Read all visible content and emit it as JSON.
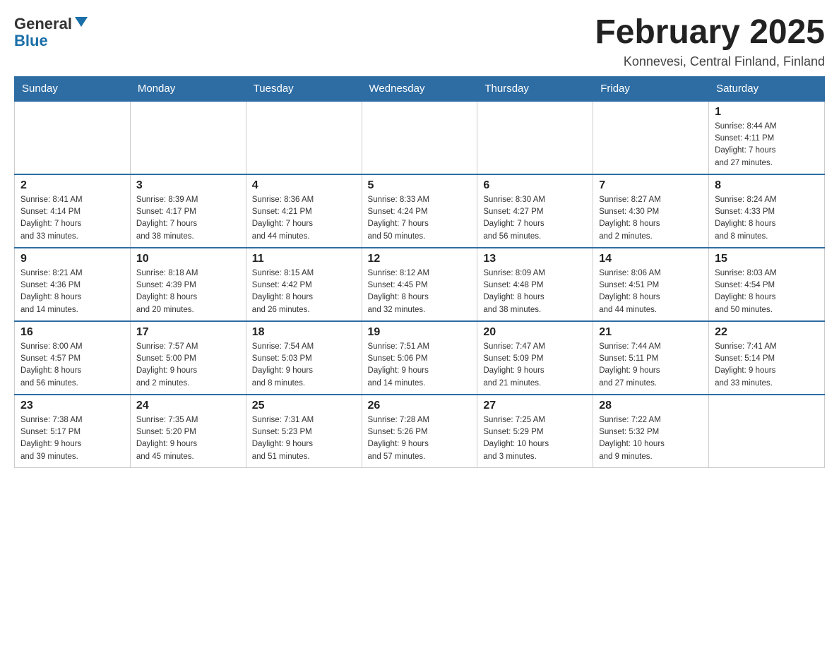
{
  "header": {
    "logo_general": "General",
    "logo_blue": "Blue",
    "month_title": "February 2025",
    "location": "Konnevesi, Central Finland, Finland"
  },
  "weekdays": [
    "Sunday",
    "Monday",
    "Tuesday",
    "Wednesday",
    "Thursday",
    "Friday",
    "Saturday"
  ],
  "weeks": [
    [
      {
        "day": "",
        "info": ""
      },
      {
        "day": "",
        "info": ""
      },
      {
        "day": "",
        "info": ""
      },
      {
        "day": "",
        "info": ""
      },
      {
        "day": "",
        "info": ""
      },
      {
        "day": "",
        "info": ""
      },
      {
        "day": "1",
        "info": "Sunrise: 8:44 AM\nSunset: 4:11 PM\nDaylight: 7 hours\nand 27 minutes."
      }
    ],
    [
      {
        "day": "2",
        "info": "Sunrise: 8:41 AM\nSunset: 4:14 PM\nDaylight: 7 hours\nand 33 minutes."
      },
      {
        "day": "3",
        "info": "Sunrise: 8:39 AM\nSunset: 4:17 PM\nDaylight: 7 hours\nand 38 minutes."
      },
      {
        "day": "4",
        "info": "Sunrise: 8:36 AM\nSunset: 4:21 PM\nDaylight: 7 hours\nand 44 minutes."
      },
      {
        "day": "5",
        "info": "Sunrise: 8:33 AM\nSunset: 4:24 PM\nDaylight: 7 hours\nand 50 minutes."
      },
      {
        "day": "6",
        "info": "Sunrise: 8:30 AM\nSunset: 4:27 PM\nDaylight: 7 hours\nand 56 minutes."
      },
      {
        "day": "7",
        "info": "Sunrise: 8:27 AM\nSunset: 4:30 PM\nDaylight: 8 hours\nand 2 minutes."
      },
      {
        "day": "8",
        "info": "Sunrise: 8:24 AM\nSunset: 4:33 PM\nDaylight: 8 hours\nand 8 minutes."
      }
    ],
    [
      {
        "day": "9",
        "info": "Sunrise: 8:21 AM\nSunset: 4:36 PM\nDaylight: 8 hours\nand 14 minutes."
      },
      {
        "day": "10",
        "info": "Sunrise: 8:18 AM\nSunset: 4:39 PM\nDaylight: 8 hours\nand 20 minutes."
      },
      {
        "day": "11",
        "info": "Sunrise: 8:15 AM\nSunset: 4:42 PM\nDaylight: 8 hours\nand 26 minutes."
      },
      {
        "day": "12",
        "info": "Sunrise: 8:12 AM\nSunset: 4:45 PM\nDaylight: 8 hours\nand 32 minutes."
      },
      {
        "day": "13",
        "info": "Sunrise: 8:09 AM\nSunset: 4:48 PM\nDaylight: 8 hours\nand 38 minutes."
      },
      {
        "day": "14",
        "info": "Sunrise: 8:06 AM\nSunset: 4:51 PM\nDaylight: 8 hours\nand 44 minutes."
      },
      {
        "day": "15",
        "info": "Sunrise: 8:03 AM\nSunset: 4:54 PM\nDaylight: 8 hours\nand 50 minutes."
      }
    ],
    [
      {
        "day": "16",
        "info": "Sunrise: 8:00 AM\nSunset: 4:57 PM\nDaylight: 8 hours\nand 56 minutes."
      },
      {
        "day": "17",
        "info": "Sunrise: 7:57 AM\nSunset: 5:00 PM\nDaylight: 9 hours\nand 2 minutes."
      },
      {
        "day": "18",
        "info": "Sunrise: 7:54 AM\nSunset: 5:03 PM\nDaylight: 9 hours\nand 8 minutes."
      },
      {
        "day": "19",
        "info": "Sunrise: 7:51 AM\nSunset: 5:06 PM\nDaylight: 9 hours\nand 14 minutes."
      },
      {
        "day": "20",
        "info": "Sunrise: 7:47 AM\nSunset: 5:09 PM\nDaylight: 9 hours\nand 21 minutes."
      },
      {
        "day": "21",
        "info": "Sunrise: 7:44 AM\nSunset: 5:11 PM\nDaylight: 9 hours\nand 27 minutes."
      },
      {
        "day": "22",
        "info": "Sunrise: 7:41 AM\nSunset: 5:14 PM\nDaylight: 9 hours\nand 33 minutes."
      }
    ],
    [
      {
        "day": "23",
        "info": "Sunrise: 7:38 AM\nSunset: 5:17 PM\nDaylight: 9 hours\nand 39 minutes."
      },
      {
        "day": "24",
        "info": "Sunrise: 7:35 AM\nSunset: 5:20 PM\nDaylight: 9 hours\nand 45 minutes."
      },
      {
        "day": "25",
        "info": "Sunrise: 7:31 AM\nSunset: 5:23 PM\nDaylight: 9 hours\nand 51 minutes."
      },
      {
        "day": "26",
        "info": "Sunrise: 7:28 AM\nSunset: 5:26 PM\nDaylight: 9 hours\nand 57 minutes."
      },
      {
        "day": "27",
        "info": "Sunrise: 7:25 AM\nSunset: 5:29 PM\nDaylight: 10 hours\nand 3 minutes."
      },
      {
        "day": "28",
        "info": "Sunrise: 7:22 AM\nSunset: 5:32 PM\nDaylight: 10 hours\nand 9 minutes."
      },
      {
        "day": "",
        "info": ""
      }
    ]
  ]
}
